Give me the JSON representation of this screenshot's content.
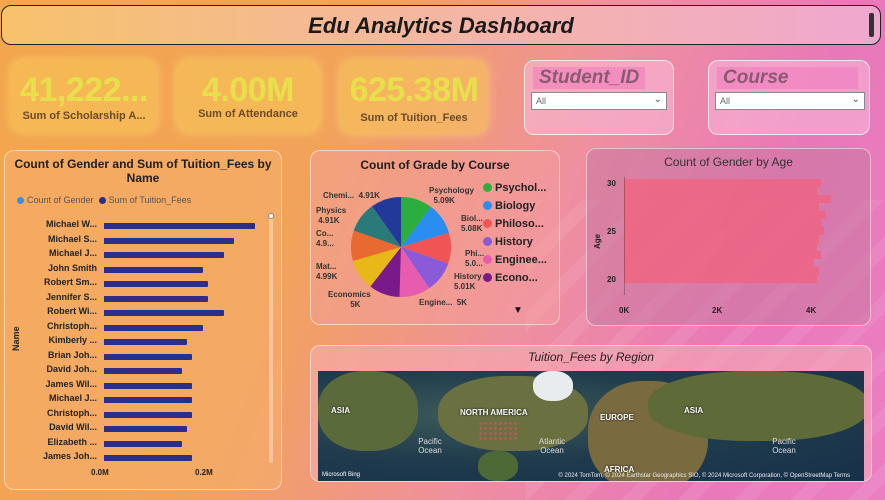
{
  "header": {
    "title": "Edu Analytics Dashboard"
  },
  "kpis": [
    {
      "value": "41,222...",
      "label": "Sum of Scholarship A..."
    },
    {
      "value": "4.00M",
      "label": "Sum of Attendance"
    },
    {
      "value": "625.38M",
      "label": "Sum of Tuition_Fees"
    }
  ],
  "slicers": [
    {
      "title": "Student_ID",
      "selected": "All"
    },
    {
      "title": "Course",
      "selected": "All"
    }
  ],
  "bar_chart": {
    "title_line1": "Count of Gender and Sum of Tuition_Fees by",
    "title_line2": "Name",
    "legend": [
      "Count of Gender",
      "Sum of Tuition_Fees"
    ],
    "legend_colors": [
      "#3b8ee8",
      "#2c2f8a"
    ],
    "axis_label": "Name",
    "x_ticks": [
      "0.0M",
      "0.2M"
    ]
  },
  "pie_chart": {
    "title": "Count of Grade by Course",
    "legend": [
      "Psychol...",
      "Biology",
      "Philoso...",
      "History",
      "Enginee...",
      "Econo..."
    ],
    "legend_colors": [
      "#2cae3c",
      "#2a8ef0",
      "#f05454",
      "#8a5ad8",
      "#e85cb0",
      "#7a1a8a"
    ],
    "labels": [
      {
        "name": "Psychology",
        "value": "5.09K"
      },
      {
        "name": "Biol...",
        "value": "5.08K"
      },
      {
        "name": "Phi...",
        "value": "5.0..."
      },
      {
        "name": "History",
        "value": "5.01K"
      },
      {
        "name": "Engine...",
        "value": "5K"
      },
      {
        "name": "Economics",
        "value": "5K"
      },
      {
        "name": "Mat...",
        "value": "4.99K"
      },
      {
        "name": "Co...",
        "value": "4.9..."
      },
      {
        "name": "Physics",
        "value": "4.91K"
      },
      {
        "name": "Chemi...",
        "value": "4.91K"
      }
    ]
  },
  "age_chart": {
    "title": "Count of Gender by Age",
    "axis_label": "Age",
    "y_ticks": [
      "30",
      "25",
      "20"
    ],
    "x_ticks": [
      "0K",
      "2K",
      "4K"
    ]
  },
  "map": {
    "title": "Tuition_Fees by Region",
    "labels": [
      "ASIA",
      "NORTH AMERICA",
      "EUROPE",
      "ASIA",
      "AFRICA"
    ],
    "oceans": [
      "Pacific Ocean",
      "Atlantic Ocean",
      "Pacific Ocean"
    ],
    "logo": "Microsoft Bing",
    "credit": "© 2024 TomTom, © 2024 Earthstar Geographics SIO, © 2024 Microsoft Corporation, © OpenStreetMap  Terms"
  },
  "chart_data": [
    {
      "type": "bar",
      "title": "Count of Gender and Sum of Tuition_Fees by Name",
      "ylabel": "Name",
      "categories": [
        "Michael W...",
        "Michael S...",
        "Michael J...",
        "John Smith",
        "Robert Sm...",
        "Jennifer S...",
        "Robert Wi...",
        "Christoph...",
        "Kimberly ...",
        "Brian Joh...",
        "David Joh...",
        "James Wil...",
        "Michael J...",
        "Christoph...",
        "David Wil...",
        "Elizabeth ...",
        "James Joh..."
      ],
      "series": [
        {
          "name": "Sum of Tuition_Fees",
          "values": [
            0.29,
            0.25,
            0.23,
            0.19,
            0.2,
            0.2,
            0.23,
            0.19,
            0.16,
            0.17,
            0.15,
            0.17,
            0.17,
            0.17,
            0.16,
            0.15,
            0.17
          ]
        }
      ],
      "xlim": [
        0,
        0.3
      ]
    },
    {
      "type": "pie",
      "title": "Count of Grade by Course",
      "categories": [
        "Psychology",
        "Biology",
        "Philosophy",
        "History",
        "Engineering",
        "Economics",
        "Mathematics",
        "Computer Science",
        "Physics",
        "Chemistry"
      ],
      "values": [
        5090,
        5080,
        5000,
        5010,
        5000,
        5000,
        4990,
        4900,
        4910,
        4910
      ],
      "colors": [
        "#2cae3c",
        "#2a8ef0",
        "#f05454",
        "#8a5ad8",
        "#e85cb0",
        "#7a1a8a",
        "#e8b818",
        "#e86a30",
        "#2a7a7a",
        "#23399a"
      ]
    },
    {
      "type": "bar",
      "title": "Count of Gender by Age",
      "ylabel": "Age",
      "categories": [
        30,
        29,
        28,
        27,
        26,
        25,
        24,
        23,
        22,
        21,
        20,
        19,
        18
      ],
      "values": [
        4200,
        4100,
        4400,
        4150,
        4300,
        4200,
        4250,
        4150,
        4100,
        4200,
        4050,
        4150,
        4100
      ],
      "xlim": [
        0,
        5000
      ],
      "ylim": [
        18,
        30
      ]
    }
  ]
}
